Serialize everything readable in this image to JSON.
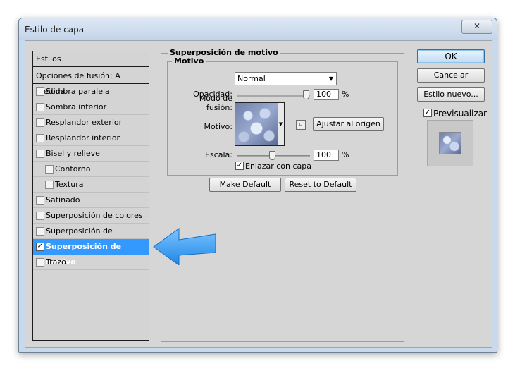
{
  "window": {
    "title": "Estilo de capa",
    "close_glyph": "✕"
  },
  "list": {
    "header": "Estilos",
    "blend_options": "Opciones de fusión: A medida",
    "items": [
      {
        "label": "Sombra paralela",
        "checked": false
      },
      {
        "label": "Sombra interior",
        "checked": false
      },
      {
        "label": "Resplandor exterior",
        "checked": false
      },
      {
        "label": "Resplandor interior",
        "checked": false
      },
      {
        "label": "Bisel y relieve",
        "checked": false
      },
      {
        "label": "Contorno",
        "checked": false
      },
      {
        "label": "Textura",
        "checked": false
      },
      {
        "label": "Satinado",
        "checked": false
      },
      {
        "label": "Superposición de colores",
        "checked": false
      },
      {
        "label": "Superposición de degradado",
        "checked": false
      },
      {
        "label": "Superposición de motivo",
        "checked": true
      },
      {
        "label": "Trazo",
        "checked": false
      }
    ]
  },
  "panel": {
    "group_title": "Superposición de motivo",
    "subgroup_title": "Motivo",
    "blend_mode_label": "Modo de fusión:",
    "blend_mode_value": "Normal",
    "opacity_label": "Opacidad:",
    "opacity_value": "100",
    "opacity_unit": "%",
    "opacity_fraction": 1.0,
    "pattern_label": "Motivo:",
    "snap_button": "Ajustar al origen",
    "scale_label": "Escala:",
    "scale_value": "100",
    "scale_unit": "%",
    "link_label": "Enlazar con capa",
    "link_checked": true,
    "make_default": "Make Default",
    "reset_default": "Reset to Default"
  },
  "side": {
    "ok": "OK",
    "cancel": "Cancelar",
    "new_style": "Estilo nuevo...",
    "preview_label": "Previsualizar",
    "preview_checked": true
  },
  "colors": {
    "selection": "#3399ff",
    "arrow": "#3a9df0"
  }
}
